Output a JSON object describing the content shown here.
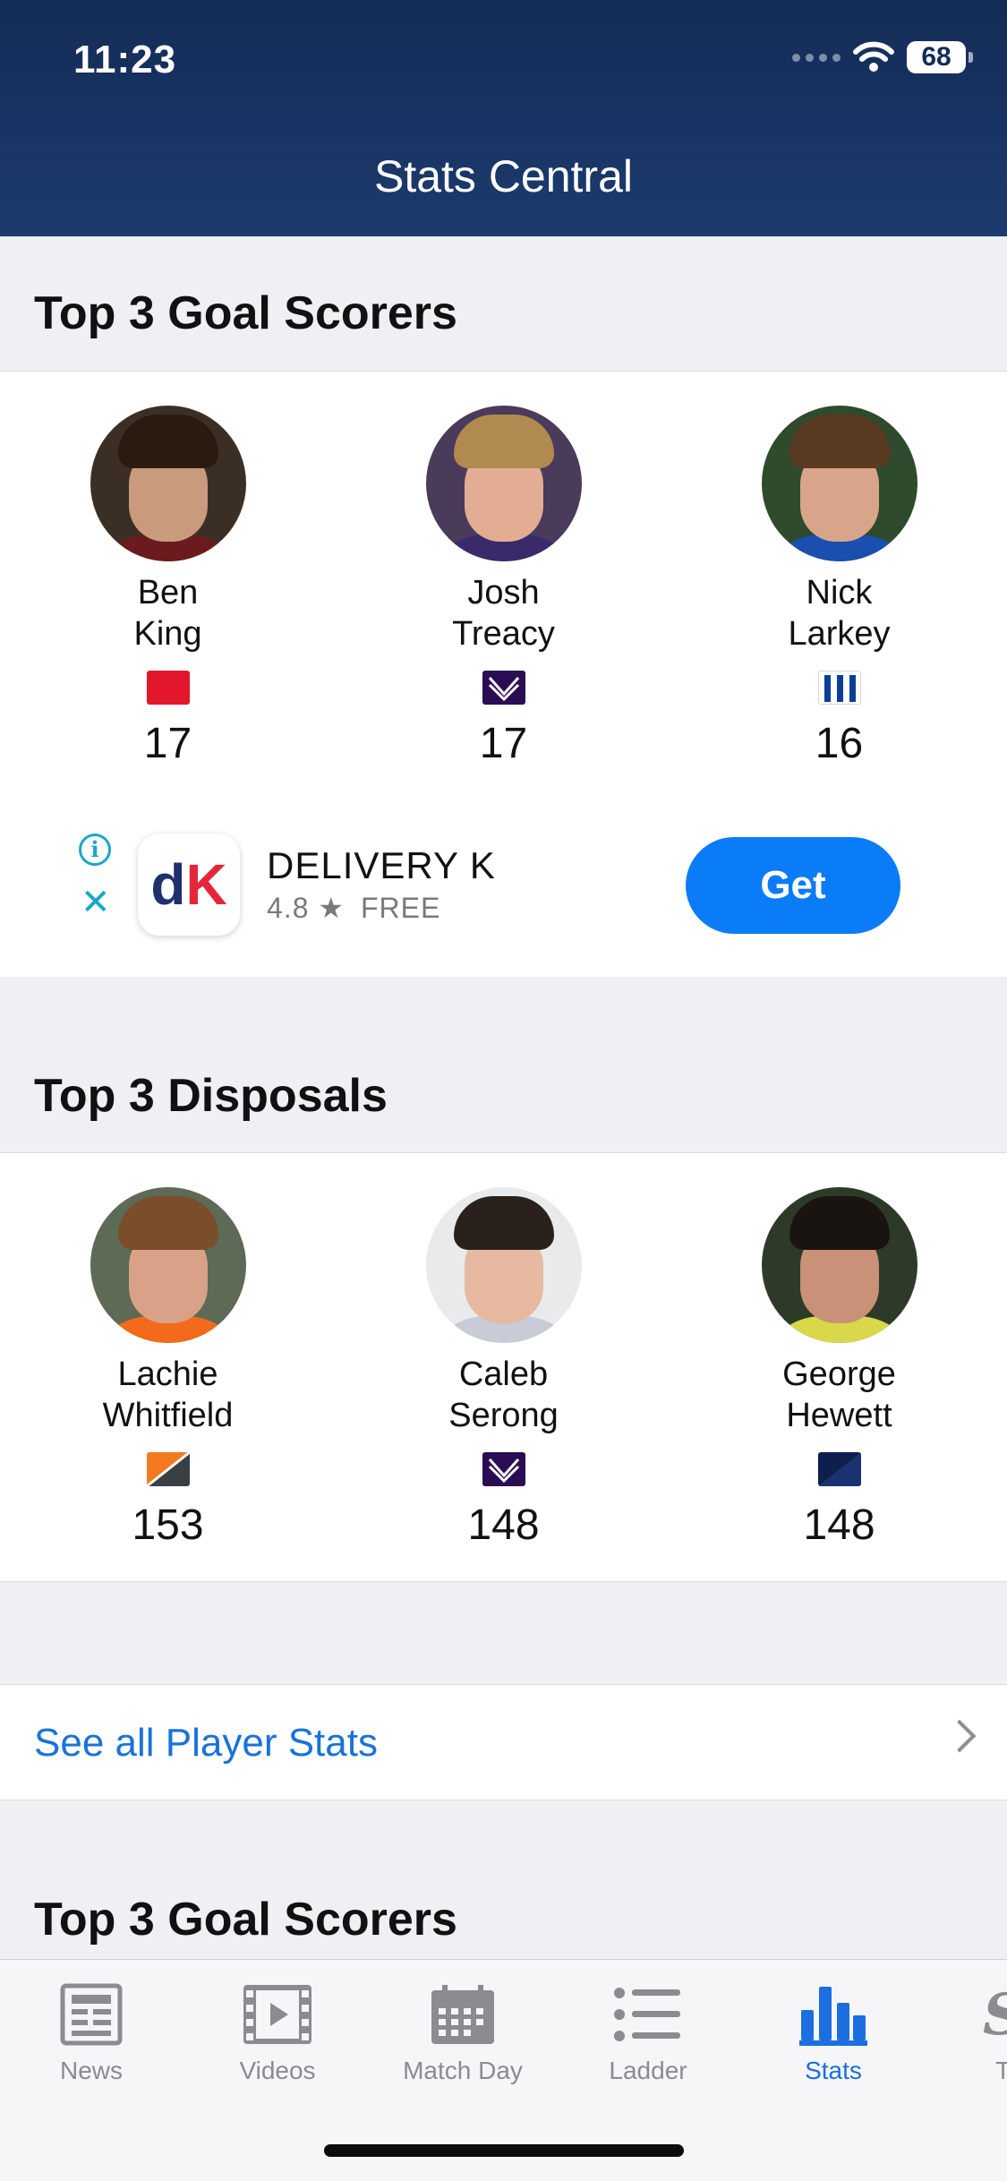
{
  "status": {
    "time": "11:23",
    "battery": "68"
  },
  "nav": {
    "title": "Stats Central"
  },
  "sections": {
    "goals_title": "Top 3 Goal Scorers",
    "disposals_title": "Top 3 Disposals",
    "goals_title_2": "Top 3 Goal Scorers"
  },
  "goal_scorers": [
    {
      "first": "Ben",
      "last": "King",
      "value": "17",
      "club_icon": "red-club-flag-icon"
    },
    {
      "first": "Josh",
      "last": "Treacy",
      "value": "17",
      "club_icon": "purple-chevron-club-flag-icon"
    },
    {
      "first": "Nick",
      "last": "Larkey",
      "value": "16",
      "club_icon": "blue-white-stripes-club-flag-icon"
    }
  ],
  "disposals": [
    {
      "first": "Lachie",
      "last": "Whitfield",
      "value": "153",
      "club_icon": "orange-charcoal-club-flag-icon"
    },
    {
      "first": "Caleb",
      "last": "Serong",
      "value": "148",
      "club_icon": "purple-chevron-club-flag-icon"
    },
    {
      "first": "George",
      "last": "Hewett",
      "value": "148",
      "club_icon": "navy-club-flag-icon"
    }
  ],
  "ad": {
    "logo_d": "d",
    "logo_k": "K",
    "name": "DELIVERY K",
    "rating": "4.8",
    "price": "FREE",
    "cta": "Get"
  },
  "see_all": {
    "label": "See all Player Stats"
  },
  "tabs": [
    {
      "label": "News",
      "icon": "newspaper-icon"
    },
    {
      "label": "Videos",
      "icon": "film-icon"
    },
    {
      "label": "Match Day",
      "icon": "calendar-icon"
    },
    {
      "label": "Ladder",
      "icon": "list-icon"
    },
    {
      "label": "Stats",
      "icon": "bar-chart-icon",
      "active": true
    },
    {
      "label": "T",
      "icon": "more-tab-icon"
    }
  ],
  "colors": {
    "header": "#1c3b6e",
    "accent": "#1b6fe0",
    "get_button": "#0a7cf7"
  }
}
